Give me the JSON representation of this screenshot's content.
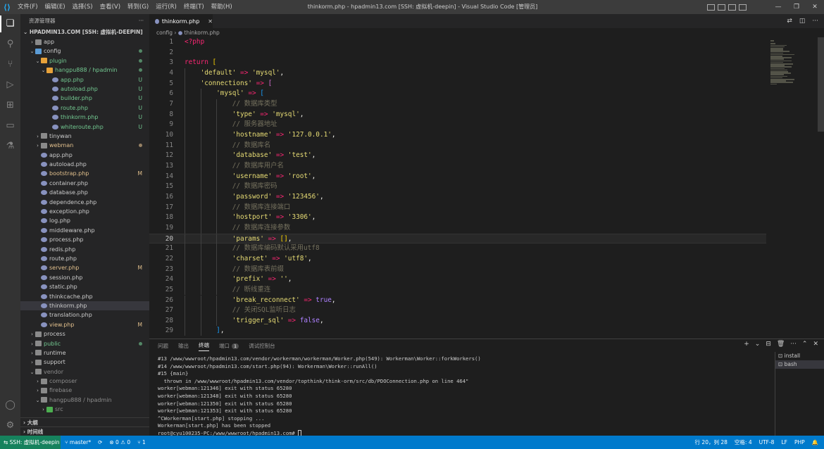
{
  "titlebar": {
    "menu": [
      "文件(F)",
      "编辑(E)",
      "选择(S)",
      "查看(V)",
      "转到(G)",
      "运行(R)",
      "终端(T)",
      "帮助(H)"
    ],
    "title": "thinkorm.php - hpadmin13.com [SSH: 虚拟机-deepin] - Visual Studio Code [管理员]"
  },
  "sidebar": {
    "header": "资源管理器",
    "more": "···",
    "root": "HPADMIN13.COM [SSH: 虚拟机-DEEPIN]",
    "tree": [
      {
        "label": "app",
        "depth": 1,
        "chev": "›",
        "icon": "folder"
      },
      {
        "label": "config",
        "depth": 1,
        "chev": "⌄",
        "icon": "config",
        "status": "dot"
      },
      {
        "label": "plugin",
        "depth": 2,
        "chev": "⌄",
        "icon": "plugin",
        "status": "dot",
        "cls": "untracked"
      },
      {
        "label": "hangpu888 / hpadmin",
        "depth": 3,
        "chev": "⌄",
        "icon": "plugin",
        "status": "dot",
        "cls": "untracked"
      },
      {
        "label": "app.php",
        "depth": 4,
        "icon": "php",
        "status": "U",
        "cls": "untracked"
      },
      {
        "label": "autoload.php",
        "depth": 4,
        "icon": "php",
        "status": "U",
        "cls": "untracked"
      },
      {
        "label": "builder.php",
        "depth": 4,
        "icon": "php",
        "status": "U",
        "cls": "untracked"
      },
      {
        "label": "route.php",
        "depth": 4,
        "icon": "php",
        "status": "U",
        "cls": "untracked"
      },
      {
        "label": "thinkorm.php",
        "depth": 4,
        "icon": "php",
        "status": "U",
        "cls": "untracked"
      },
      {
        "label": "whiteroute.php",
        "depth": 4,
        "icon": "php",
        "status": "U",
        "cls": "untracked"
      },
      {
        "label": "tinywan",
        "depth": 2,
        "chev": "›",
        "icon": "folder"
      },
      {
        "label": "webman",
        "depth": 2,
        "chev": "›",
        "icon": "folder",
        "status": "dotm",
        "cls": "mod"
      },
      {
        "label": "app.php",
        "depth": 2,
        "icon": "php"
      },
      {
        "label": "autoload.php",
        "depth": 2,
        "icon": "php"
      },
      {
        "label": "bootstrap.php",
        "depth": 2,
        "icon": "php",
        "status": "M",
        "cls": "mod"
      },
      {
        "label": "container.php",
        "depth": 2,
        "icon": "php"
      },
      {
        "label": "database.php",
        "depth": 2,
        "icon": "php"
      },
      {
        "label": "dependence.php",
        "depth": 2,
        "icon": "php"
      },
      {
        "label": "exception.php",
        "depth": 2,
        "icon": "php"
      },
      {
        "label": "log.php",
        "depth": 2,
        "icon": "php"
      },
      {
        "label": "middleware.php",
        "depth": 2,
        "icon": "php"
      },
      {
        "label": "process.php",
        "depth": 2,
        "icon": "php"
      },
      {
        "label": "redis.php",
        "depth": 2,
        "icon": "php"
      },
      {
        "label": "route.php",
        "depth": 2,
        "icon": "php"
      },
      {
        "label": "server.php",
        "depth": 2,
        "icon": "php",
        "status": "M",
        "cls": "mod"
      },
      {
        "label": "session.php",
        "depth": 2,
        "icon": "php"
      },
      {
        "label": "static.php",
        "depth": 2,
        "icon": "php"
      },
      {
        "label": "thinkcache.php",
        "depth": 2,
        "icon": "php"
      },
      {
        "label": "thinkorm.php",
        "depth": 2,
        "icon": "php",
        "selected": true
      },
      {
        "label": "translation.php",
        "depth": 2,
        "icon": "php"
      },
      {
        "label": "view.php",
        "depth": 2,
        "icon": "php",
        "status": "M",
        "cls": "mod"
      },
      {
        "label": "process",
        "depth": 1,
        "chev": "›",
        "icon": "folder"
      },
      {
        "label": "public",
        "depth": 1,
        "chev": "›",
        "icon": "folder",
        "status": "dot",
        "cls": "untracked"
      },
      {
        "label": "runtime",
        "depth": 1,
        "chev": "›",
        "icon": "folder"
      },
      {
        "label": "support",
        "depth": 1,
        "chev": "›",
        "icon": "folder"
      },
      {
        "label": "vendor",
        "depth": 1,
        "chev": "⌄",
        "icon": "folder",
        "cls": "dim"
      },
      {
        "label": "composer",
        "depth": 2,
        "chev": "›",
        "icon": "folder",
        "cls": "dim"
      },
      {
        "label": "firebase",
        "depth": 2,
        "chev": "›",
        "icon": "folder",
        "cls": "dim"
      },
      {
        "label": "hangpu888 / hpadmin",
        "depth": 2,
        "chev": "⌄",
        "icon": "folder",
        "cls": "dim"
      },
      {
        "label": "src",
        "depth": 3,
        "chev": "›",
        "icon": "src",
        "cls": "dim"
      }
    ],
    "outline": "大纲",
    "timeline": "时间线"
  },
  "editor": {
    "tab_label": "thinkorm.php",
    "breadcrumb": [
      "config",
      "thinkorm.php"
    ],
    "current_line": 20,
    "lines": [
      [
        [
          "k",
          "<?php"
        ]
      ],
      [],
      [
        [
          "k",
          "return"
        ],
        [
          "p",
          " "
        ],
        [
          "brk",
          "["
        ]
      ],
      [
        [
          "p",
          "    "
        ],
        [
          "s",
          "'default'"
        ],
        [
          "p",
          " "
        ],
        [
          "k",
          "=>"
        ],
        [
          "p",
          " "
        ],
        [
          "s",
          "'mysql'"
        ],
        [
          "p",
          ","
        ]
      ],
      [
        [
          "p",
          "    "
        ],
        [
          "s",
          "'connections'"
        ],
        [
          "p",
          " "
        ],
        [
          "k",
          "=>"
        ],
        [
          "p",
          " "
        ],
        [
          "brk2",
          "["
        ]
      ],
      [
        [
          "p",
          "        "
        ],
        [
          "s",
          "'mysql'"
        ],
        [
          "p",
          " "
        ],
        [
          "k",
          "=>"
        ],
        [
          "p",
          " "
        ],
        [
          "brk3",
          "["
        ]
      ],
      [
        [
          "p",
          "            "
        ],
        [
          "c",
          "// 数据库类型"
        ]
      ],
      [
        [
          "p",
          "            "
        ],
        [
          "s",
          "'type'"
        ],
        [
          "p",
          " "
        ],
        [
          "k",
          "=>"
        ],
        [
          "p",
          " "
        ],
        [
          "s",
          "'mysql'"
        ],
        [
          "p",
          ","
        ]
      ],
      [
        [
          "p",
          "            "
        ],
        [
          "c",
          "// 服务器地址"
        ]
      ],
      [
        [
          "p",
          "            "
        ],
        [
          "s",
          "'hostname'"
        ],
        [
          "p",
          " "
        ],
        [
          "k",
          "=>"
        ],
        [
          "p",
          " "
        ],
        [
          "s",
          "'127.0.0.1'"
        ],
        [
          "p",
          ","
        ]
      ],
      [
        [
          "p",
          "            "
        ],
        [
          "c",
          "// 数据库名"
        ]
      ],
      [
        [
          "p",
          "            "
        ],
        [
          "s",
          "'database'"
        ],
        [
          "p",
          " "
        ],
        [
          "k",
          "=>"
        ],
        [
          "p",
          " "
        ],
        [
          "s",
          "'test'"
        ],
        [
          "p",
          ","
        ]
      ],
      [
        [
          "p",
          "            "
        ],
        [
          "c",
          "// 数据库用户名"
        ]
      ],
      [
        [
          "p",
          "            "
        ],
        [
          "s",
          "'username'"
        ],
        [
          "p",
          " "
        ],
        [
          "k",
          "=>"
        ],
        [
          "p",
          " "
        ],
        [
          "s",
          "'root'"
        ],
        [
          "p",
          ","
        ]
      ],
      [
        [
          "p",
          "            "
        ],
        [
          "c",
          "// 数据库密码"
        ]
      ],
      [
        [
          "p",
          "            "
        ],
        [
          "s",
          "'password'"
        ],
        [
          "p",
          " "
        ],
        [
          "k",
          "=>"
        ],
        [
          "p",
          " "
        ],
        [
          "s",
          "'123456'"
        ],
        [
          "p",
          ","
        ]
      ],
      [
        [
          "p",
          "            "
        ],
        [
          "c",
          "// 数据库连接端口"
        ]
      ],
      [
        [
          "p",
          "            "
        ],
        [
          "s",
          "'hostport'"
        ],
        [
          "p",
          " "
        ],
        [
          "k",
          "=>"
        ],
        [
          "p",
          " "
        ],
        [
          "s",
          "'3306'"
        ],
        [
          "p",
          ","
        ]
      ],
      [
        [
          "p",
          "            "
        ],
        [
          "c",
          "// 数据库连接参数"
        ]
      ],
      [
        [
          "p",
          "            "
        ],
        [
          "s",
          "'params'"
        ],
        [
          "p",
          " "
        ],
        [
          "k",
          "=>"
        ],
        [
          "p",
          " "
        ],
        [
          "brk",
          "[]"
        ],
        [
          "p",
          ","
        ]
      ],
      [
        [
          "p",
          "            "
        ],
        [
          "c",
          "// 数据库编码默认采用utf8"
        ]
      ],
      [
        [
          "p",
          "            "
        ],
        [
          "s",
          "'charset'"
        ],
        [
          "p",
          " "
        ],
        [
          "k",
          "=>"
        ],
        [
          "p",
          " "
        ],
        [
          "s",
          "'utf8'"
        ],
        [
          "p",
          ","
        ]
      ],
      [
        [
          "p",
          "            "
        ],
        [
          "c",
          "// 数据库表前缀"
        ]
      ],
      [
        [
          "p",
          "            "
        ],
        [
          "s",
          "'prefix'"
        ],
        [
          "p",
          " "
        ],
        [
          "k",
          "=>"
        ],
        [
          "p",
          " "
        ],
        [
          "s",
          "''"
        ],
        [
          "p",
          ","
        ]
      ],
      [
        [
          "p",
          "            "
        ],
        [
          "c",
          "// 断线重连"
        ]
      ],
      [
        [
          "p",
          "            "
        ],
        [
          "s",
          "'break_reconnect'"
        ],
        [
          "p",
          " "
        ],
        [
          "k",
          "=>"
        ],
        [
          "p",
          " "
        ],
        [
          "b",
          "true"
        ],
        [
          "p",
          ","
        ]
      ],
      [
        [
          "p",
          "            "
        ],
        [
          "c",
          "// 关闭SQL监听日志"
        ]
      ],
      [
        [
          "p",
          "            "
        ],
        [
          "s",
          "'trigger_sql'"
        ],
        [
          "p",
          " "
        ],
        [
          "k",
          "=>"
        ],
        [
          "p",
          " "
        ],
        [
          "b",
          "false"
        ],
        [
          "p",
          ","
        ]
      ],
      [
        [
          "p",
          "        "
        ],
        [
          "brk3",
          "]"
        ],
        [
          "p",
          ","
        ]
      ]
    ]
  },
  "panel": {
    "tabs": [
      "问题",
      "输出",
      "终端",
      "端口",
      "调试控制台"
    ],
    "active_tab": "终端",
    "ports_badge": "1",
    "actions": [
      "+",
      "⌄",
      "⊟",
      "🗑",
      "···",
      "⌃",
      "✕"
    ],
    "terminal_lines": [
      "#13 /www/wwwroot/hpadmin13.com/vendor/workerman/workerman/Worker.php(549): Workerman\\Worker::forkWorkers()",
      "#14 /www/wwwroot/hpadmin13.com/start.php(94): Workerman\\Worker::runAll()",
      "#15 {main}",
      "  thrown in /www/wwwroot/hpadmin13.com/vendor/topthink/think-orm/src/db/PDOConnection.php on line 464\"",
      "worker[webman:121346] exit with status 65280",
      "worker[webman:121348] exit with status 65280",
      "worker[webman:121350] exit with status 65280",
      "worker[webman:121353] exit with status 65280",
      "^CWorkerman[start.php] stopping ...",
      "Workerman[start.php] has been stopped",
      "root@cyu100235-PC:/www/wwwroot/hpadmin13.com# "
    ],
    "terminals": [
      "install",
      "bash"
    ]
  },
  "statusbar": {
    "remote": "SSH: 虚拟机-deepin",
    "branch": "master*",
    "sync": "⟳",
    "problems": "⊗ 0 ⚠ 0",
    "ports": "⑂ 1",
    "position": "行 20，列 28",
    "spaces": "空格: 4",
    "encoding": "UTF-8",
    "eol": "LF",
    "language": "PHP"
  }
}
